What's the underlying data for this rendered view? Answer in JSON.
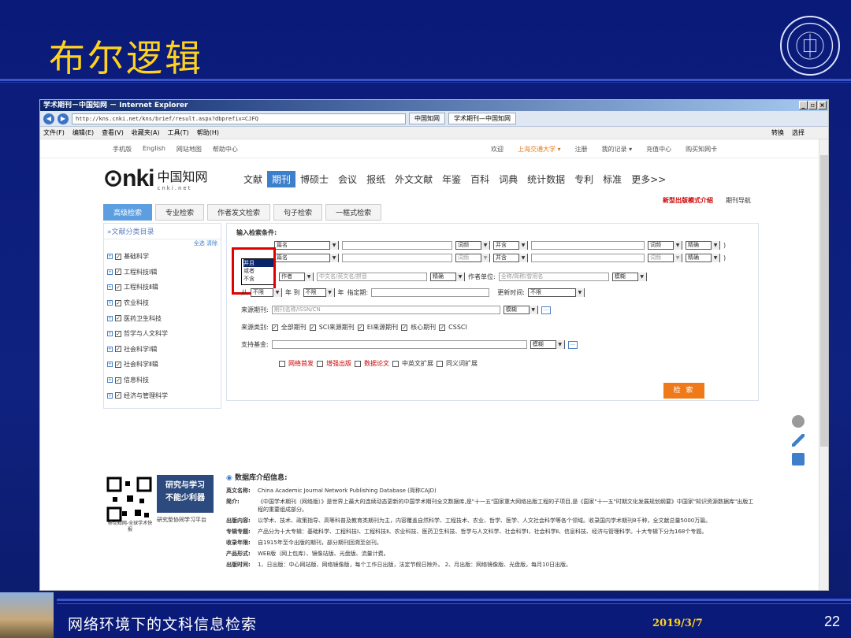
{
  "slide": {
    "title": "布尔逻辑",
    "footer_text": "网络环境下的文科信息检索",
    "footer_date": "2019/3/7",
    "page_number": "22"
  },
  "browser": {
    "window_title": "学术期刊－中国知网 － Internet Explorer",
    "url": "http://kns.cnki.net/kns/brief/result.aspx?dbprefix=CJFQ",
    "tabs": [
      "中国知网",
      "学术期刊—中国知网"
    ],
    "menu": [
      "文件(F)",
      "编辑(E)",
      "查看(V)",
      "收藏夹(A)",
      "工具(T)",
      "帮助(H)"
    ],
    "menu_right": [
      "转换",
      "选择"
    ]
  },
  "cnki": {
    "topnav_left": [
      "手机版",
      "English",
      "网站地图",
      "帮助中心"
    ],
    "topnav_right": [
      "欢迎",
      "上海交通大学 ▾",
      "注册",
      "我的记录 ▾",
      "充值中心",
      "购买知网卡"
    ],
    "logo_cn": "中国知网",
    "logo_net": "cnki.net",
    "main_tabs": [
      "文献",
      "期刊",
      "博硕士",
      "会议",
      "报纸",
      "外文文献",
      "年鉴",
      "百科",
      "词典",
      "统计数据",
      "专利",
      "标准",
      "更多>>"
    ],
    "new_link": "新型出版模式介绍",
    "journal_nav": "期刊导航",
    "search_tabs": [
      "高级检索",
      "专业检索",
      "作者发文检索",
      "句子检索",
      "一框式检索"
    ],
    "sidebar_head": "»文献分类目录",
    "sidebar_select": "全选  清除",
    "categories": [
      "基础科学",
      "工程科技Ⅰ辑",
      "工程科技Ⅱ辑",
      "农业科技",
      "医药卫生科技",
      "哲学与人文科学",
      "社会科学Ⅰ辑",
      "社会科学Ⅱ辑",
      "信息科技",
      "经济与管理科学"
    ]
  },
  "form": {
    "label_input": "输入检索条件:",
    "field1": "篇名",
    "field2": "篇名",
    "freq": "词频",
    "and": "并含",
    "precise": "精确",
    "dropdown_options": [
      "并且",
      "或者",
      "不含"
    ],
    "author": "作者",
    "author_ph": "中文名/英文名/拼音",
    "author_unit": "作者单位:",
    "unit_ph": "全称/简称/曾用名",
    "fuzzy": "模糊",
    "from": "从",
    "unlimited": "不限",
    "year_to": "年 到",
    "year": "年",
    "date_label": "指定期:",
    "update_label": "更新时间:",
    "source_label": "来源期刊:",
    "source_ph": "期刊名称/ISSN/CN",
    "category_label": "来源类别:",
    "source_types": [
      "全部期刊",
      "SCI来源期刊",
      "EI来源期刊",
      "核心期刊",
      "CSSCI"
    ],
    "fund_label": "支持基金:",
    "options": [
      "网络首发",
      "增强出版",
      "数据论文",
      "中英文扩展",
      "同义词扩展"
    ],
    "search_button": "检 索"
  },
  "promo": {
    "title1": "研究与学习",
    "title2": "不能少利器",
    "sub": "研究型协同学习平台",
    "qr_caption": "移动知网-全球学术快报"
  },
  "db_info": {
    "heading": "数据库介绍信息:",
    "rows": [
      {
        "k": "英文名称:",
        "v": "China Academic Journal Network Publishing Database (简称CAJD)"
      },
      {
        "k": "简介:",
        "v": "《中国学术期刊（网络版）》是世界上最大的连续动态更新的中国学术期刊全文数据库,是\"十一五\"国家重大网络出版工程的子项目,是《国家\"十一五\"时期文化发展规划纲要》中国家\"知识资源数据库\"出版工程的重要组成部分。"
      },
      {
        "k": "出版内容:",
        "v": "以学术、技术、政策指导、高等科普及教育类期刊为主，内容覆盖自然科学、工程技术、农业、哲学、医学、人文社会科学等各个领域。收录国内学术期刊8千种，全文献总量5000万篇。"
      },
      {
        "k": "专辑专题:",
        "v": "产品分为十大专辑：基础科学、工程科技Ⅰ、工程科技Ⅱ、农业科技、医药卫生科技、哲学与人文科学、社会科学Ⅰ、社会科学Ⅱ、信息科技、经济与管理科学。十大专辑下分为168个专题。"
      },
      {
        "k": "收录年限:",
        "v": "自1915年至今出版的期刊，部分期刊回溯至创刊。"
      },
      {
        "k": "产品形式:",
        "v": "WEB版（网上包库）、镜像站版、光盘版、流量计费。"
      },
      {
        "k": "出版时间:",
        "v": "1、日出版：中心网站版、网络镜像版，每个工作日出版，法定节假日除外。 2、月出版：网络镜像版、光盘版，每月10日出版。"
      }
    ]
  },
  "colors": {
    "title": "#ffd21e",
    "accent": "#3d7fcb",
    "highlight": "#e00000"
  }
}
